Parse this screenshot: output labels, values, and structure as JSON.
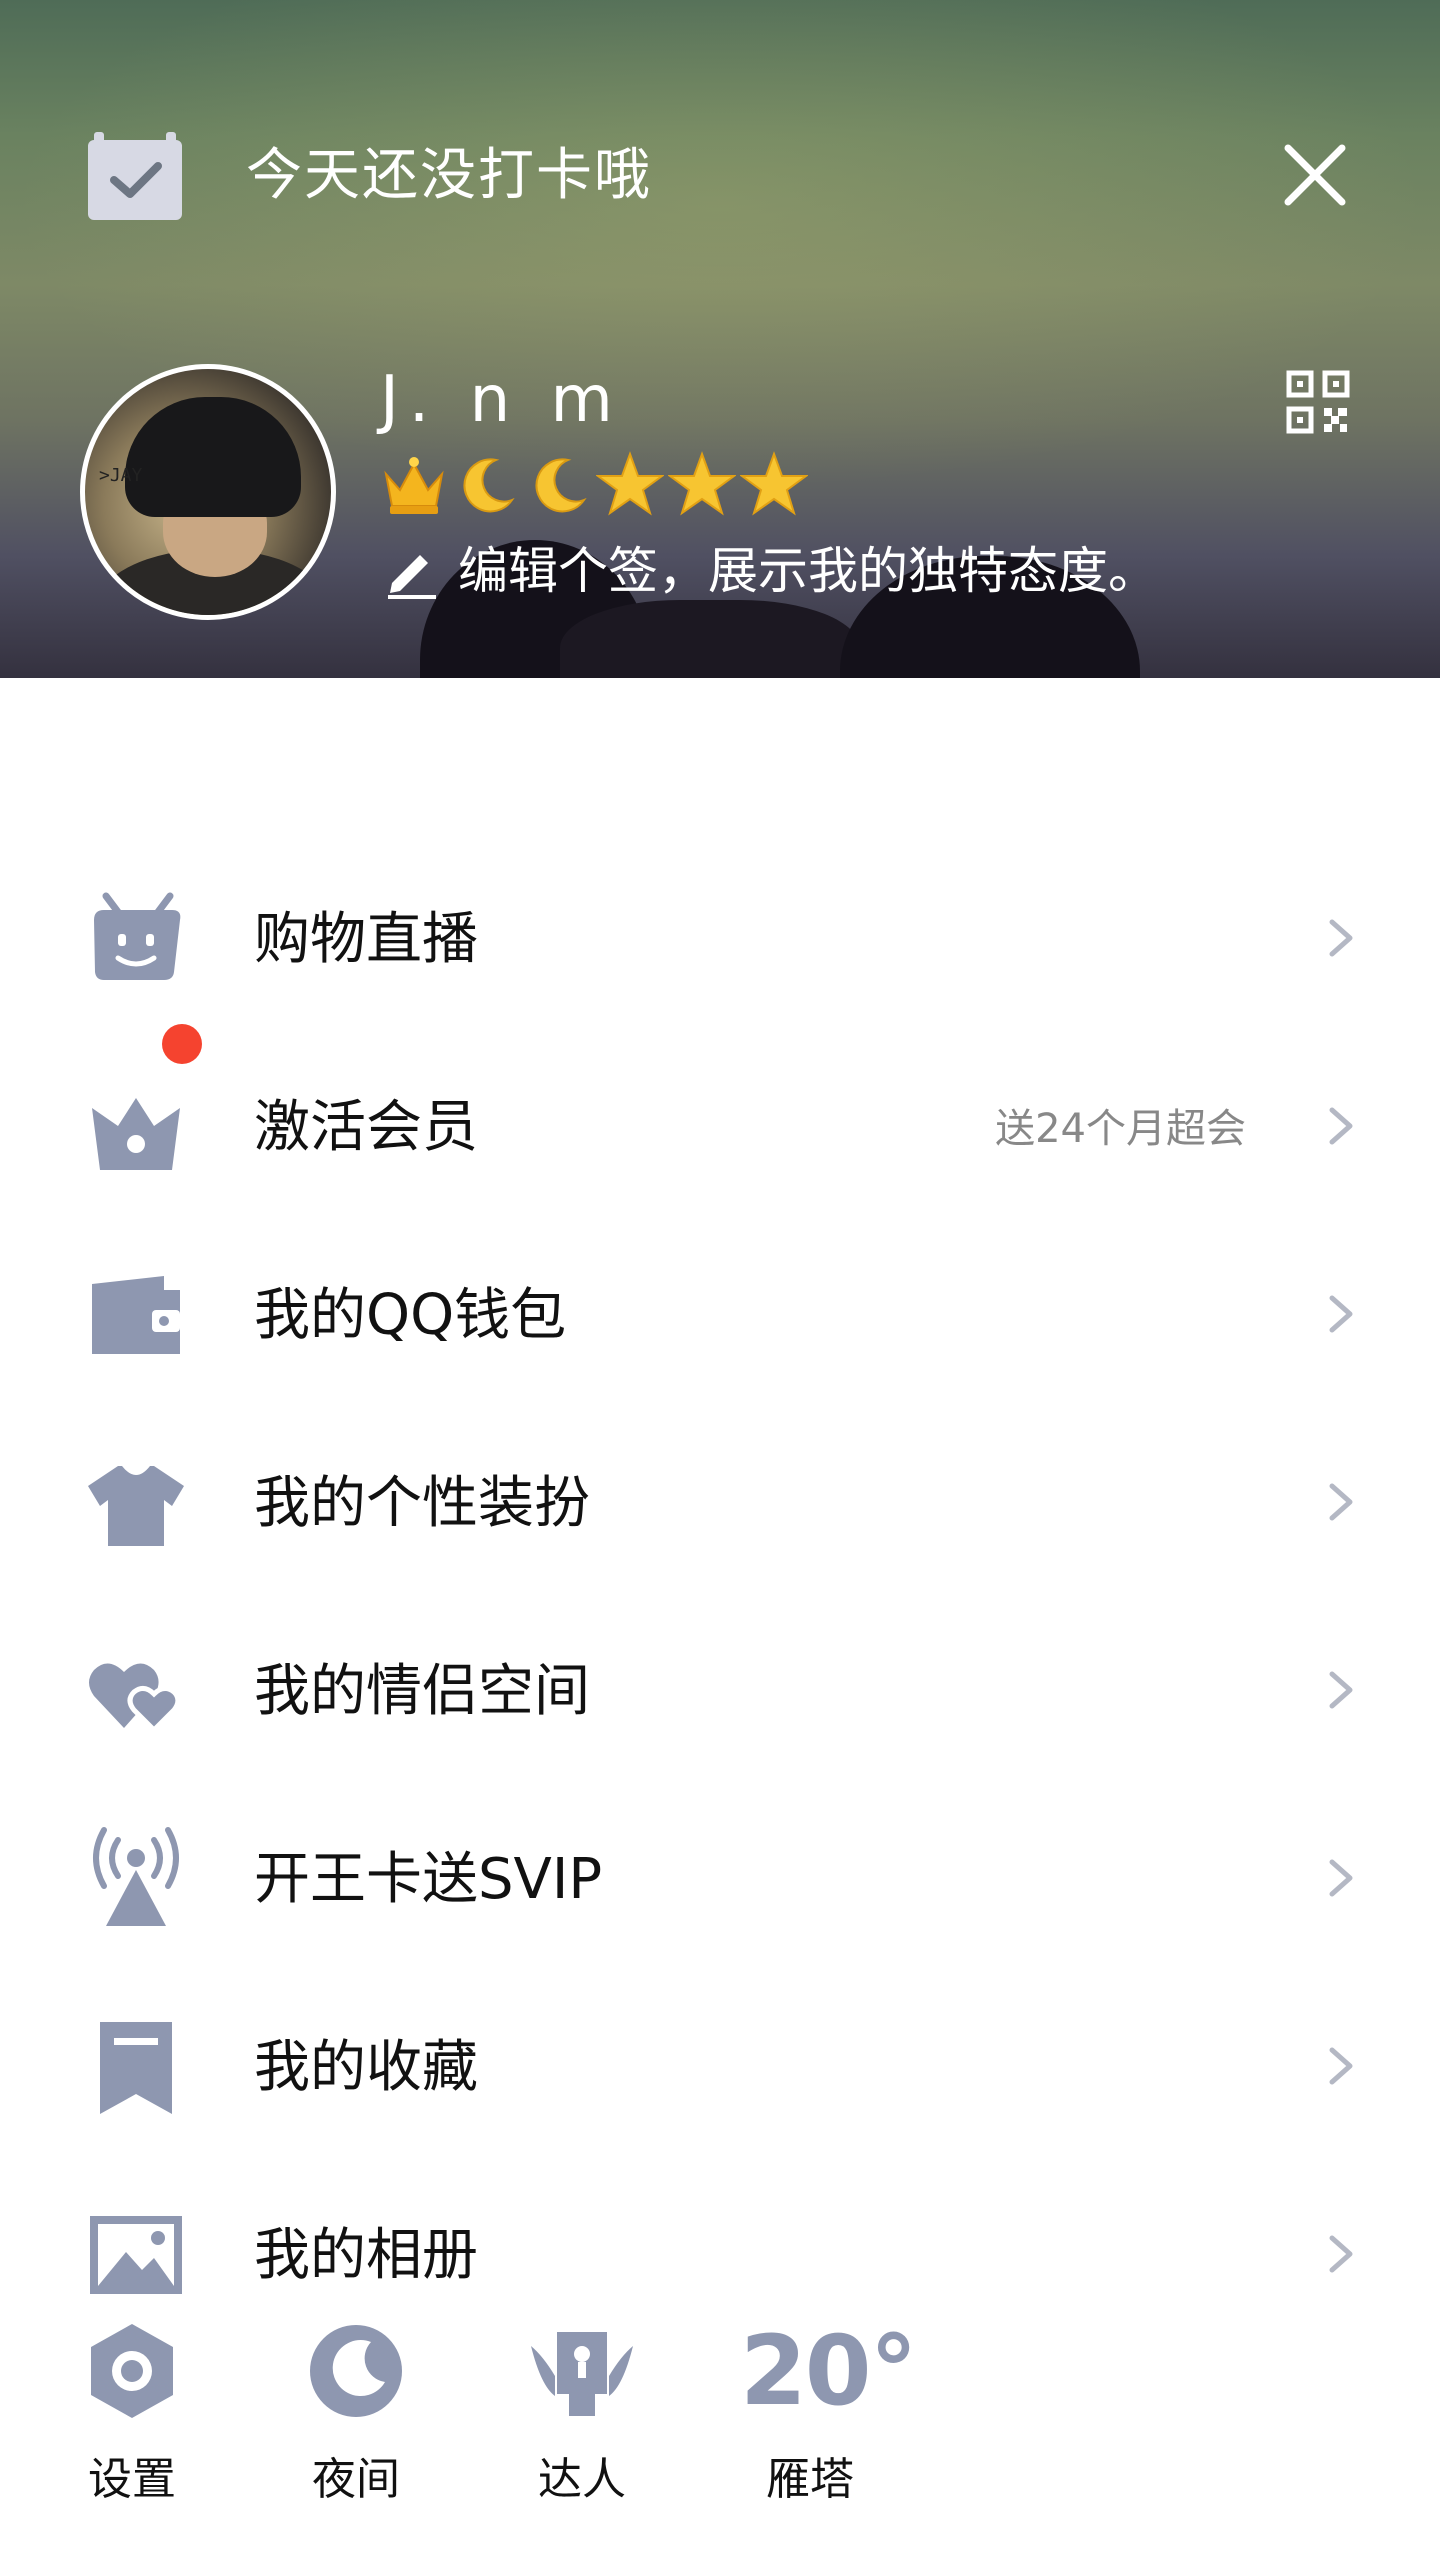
{
  "checkin": {
    "text": "今天还没打卡哦"
  },
  "profile": {
    "username": "J. n m",
    "signature": "编辑个签，展示我的独特态度。",
    "level_badges": [
      "crown",
      "moon",
      "moon",
      "star",
      "star",
      "star"
    ]
  },
  "menu": {
    "items": [
      {
        "label": "购物直播",
        "icon": "tv-robot-icon"
      },
      {
        "label": "激活会员",
        "icon": "crown-bag-icon",
        "sub": "送24个月超会",
        "badge": "red-dot"
      },
      {
        "label": "我的QQ钱包",
        "icon": "wallet-icon"
      },
      {
        "label": "我的个性装扮",
        "icon": "tshirt-icon"
      },
      {
        "label": "我的情侣空间",
        "icon": "couple-heart-icon"
      },
      {
        "label": "开王卡送SVIP",
        "icon": "signal-tower-icon"
      },
      {
        "label": "我的收藏",
        "icon": "bookmark-icon"
      },
      {
        "label": "我的相册",
        "icon": "photo-icon"
      }
    ]
  },
  "bottom": {
    "settings": "设置",
    "night": "夜间",
    "expert": "达人",
    "weather": {
      "temp": "20°",
      "city": "雁塔"
    }
  },
  "colors": {
    "icon": "#8e97b0",
    "badge_red": "#f5432f",
    "text": "#111111",
    "subtext": "#888888",
    "gold": "#f4b51e"
  }
}
